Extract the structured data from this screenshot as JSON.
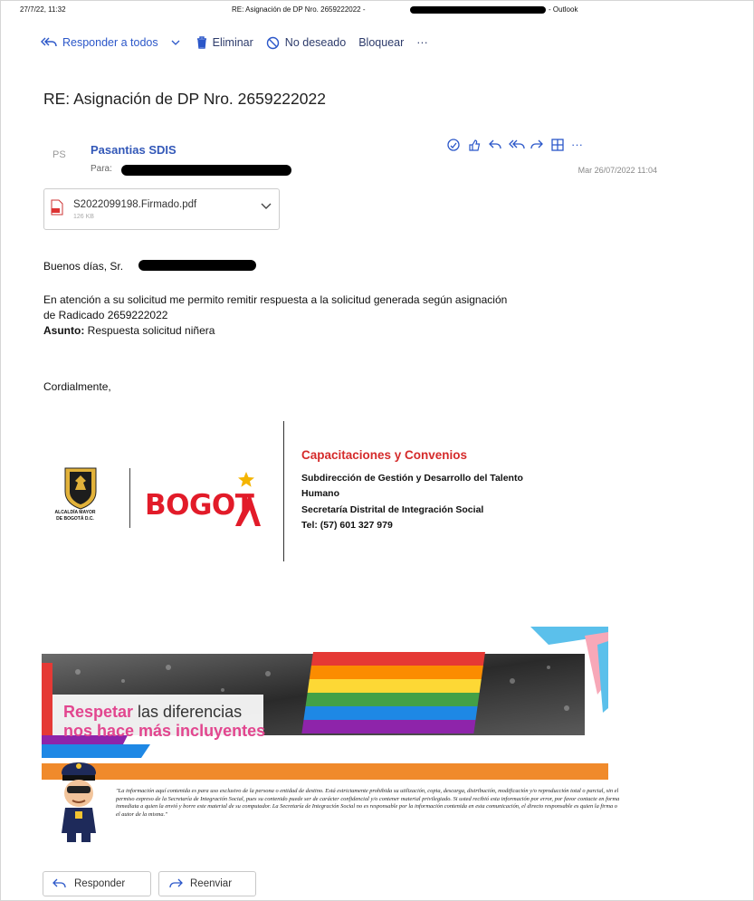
{
  "print_header": {
    "datetime": "27/7/22, 11:32",
    "title": "RE: Asignación de DP Nro. 2659222022 -",
    "app": "- Outlook"
  },
  "toolbar": {
    "reply_all": "Responder a todos",
    "delete": "Eliminar",
    "junk": "No deseado",
    "block": "Bloquear",
    "more": "···"
  },
  "message": {
    "subject": "RE: Asignación de DP Nro. 2659222022",
    "avatar_initials": "PS",
    "sender": "Pasantias SDIS",
    "to_label": "Para:",
    "date": "Mar 26/07/2022 11:04",
    "actions_more": "···"
  },
  "attachment": {
    "filename": "S2022099198.Firmado.pdf",
    "size": "126 KB"
  },
  "body": {
    "greeting": "Buenos días, Sr.",
    "line1": "En atención a su solicitud me permito remitir respuesta a la solicitud generada según asignación",
    "line2": "de Radicado 2659222022",
    "subject_label": "Asunto:",
    "subject_value": " Respuesta solicitud niñera",
    "closing": "Cordialmente,"
  },
  "signature": {
    "title": "Capacitaciones y Convenios",
    "line1": "Subdirección de Gestión y Desarrollo del Talento",
    "line2": "Humano",
    "line3": "Secretaría Distrital de Integración Social",
    "line4": "Tel: (57) 601 327 979",
    "alcaldia_line1": "ALCALDÍA MAYOR",
    "alcaldia_line2": "DE BOGOTÁ D.C.",
    "bogota": "BOGOT"
  },
  "banner": {
    "word_bold": "Respetar",
    "line1_rest": " las diferencias",
    "line2": "nos hace más incluyentes"
  },
  "disclaimer": "\"La información aquí contenida es para uso exclusivo de la persona o entidad de destino. Está estrictamente prohibida su utilización, copia, descarga, distribución, modificación y/o reproducción total o parcial, sin el permiso expreso de la Secretaría de Integración Social, pues su contenido puede ser de carácter confidencial y/o contener material privilegiado. Si usted recibió esta información por error, por favor contacte en forma inmediata a quien la envió y borre este material de su computador. La Secretaría de Integración Social no es responsable por la información contenida en esta comunicación, el directo responsable es quien la firma o el autor de la misma.\"",
  "buttons": {
    "reply": "Responder",
    "forward": "Reenviar"
  },
  "colors": {
    "accent_blue": "#2b57c9",
    "signature_red": "#d52b2b",
    "bogota_red": "#e21b29",
    "banner_pink": "#e2468f",
    "banner_orange": "#f08a2b"
  }
}
